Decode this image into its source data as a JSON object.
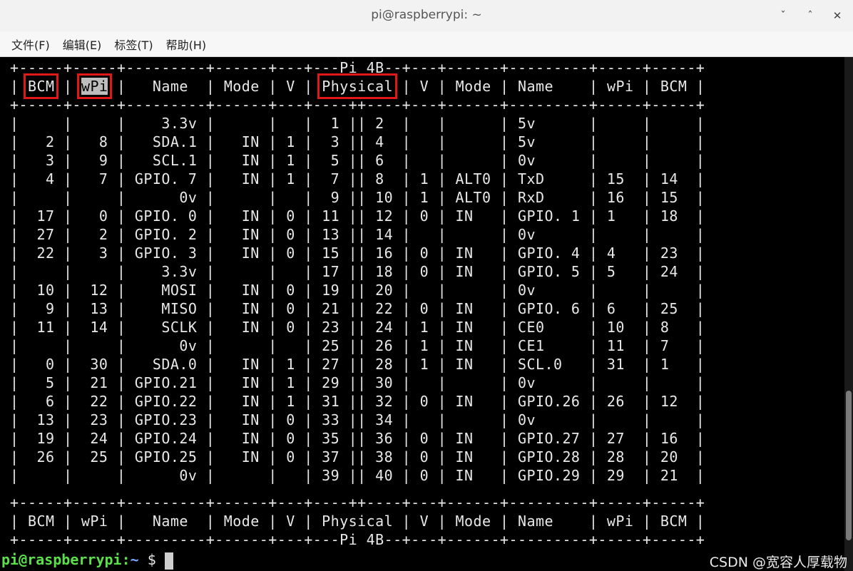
{
  "window": {
    "title": "pi@raspberrypi: ~",
    "buttons": {
      "minimize": "ˇ",
      "restore": "ˆ",
      "close": "✕"
    }
  },
  "menu": [
    "文件(F)",
    "编辑(E)",
    "标签(T)",
    "帮助(H)"
  ],
  "terminal": {
    "border_top": "+-----+-----+---------+------+---+---Pi 4B--+---+------+---------+-----+-----+",
    "header": {
      "p1": "| ",
      "bcm": "BCM",
      "p2": " | ",
      "wpi": "wPi",
      "p3": " |   Name  | Mode | V | ",
      "physical": "Physical",
      "p4": " | V | Mode | Name    | wPi | BCM |"
    },
    "border_mid": "+-----+-----+---------+------+---+----++----+---+------+---------+-----+-----+",
    "rows": [
      "|     |     |    3.3v |      |   |  1 || 2  |   |      | 5v      |     |     |",
      "|   2 |   8 |   SDA.1 |   IN | 1 |  3 || 4  |   |      | 5v      |     |     |",
      "|   3 |   9 |   SCL.1 |   IN | 1 |  5 || 6  |   |      | 0v      |     |     |",
      "|   4 |   7 | GPIO. 7 |   IN | 1 |  7 || 8  | 1 | ALT0 | TxD     | 15  | 14  |",
      "|     |     |      0v |      |   |  9 || 10 | 1 | ALT0 | RxD     | 16  | 15  |",
      "|  17 |   0 | GPIO. 0 |   IN | 0 | 11 || 12 | 0 | IN   | GPIO. 1 | 1   | 18  |",
      "|  27 |   2 | GPIO. 2 |   IN | 0 | 13 || 14 |   |      | 0v      |     |     |",
      "|  22 |   3 | GPIO. 3 |   IN | 0 | 15 || 16 | 0 | IN   | GPIO. 4 | 4   | 23  |",
      "|     |     |    3.3v |      |   | 17 || 18 | 0 | IN   | GPIO. 5 | 5   | 24  |",
      "|  10 |  12 |    MOSI |   IN | 0 | 19 || 20 |   |      | 0v      |     |     |",
      "|   9 |  13 |    MISO |   IN | 0 | 21 || 22 | 0 | IN   | GPIO. 6 | 6   | 25  |",
      "|  11 |  14 |    SCLK |   IN | 0 | 23 || 24 | 1 | IN   | CE0     | 10  | 8   |",
      "|     |     |      0v |      |   | 25 || 26 | 1 | IN   | CE1     | 11  | 7   |",
      "|   0 |  30 |   SDA.0 |   IN | 1 | 27 || 28 | 1 | IN   | SCL.0   | 31  | 1   |",
      "|   5 |  21 | GPIO.21 |   IN | 1 | 29 || 30 |   |      | 0v      |     |     |",
      "|   6 |  22 | GPIO.22 |   IN | 1 | 31 || 32 | 0 | IN   | GPIO.26 | 26  | 12  |",
      "|  13 |  23 | GPIO.23 |   IN | 0 | 33 || 34 |   |      | 0v      |     |     |",
      "|  19 |  24 | GPIO.24 |   IN | 0 | 35 || 36 | 0 | IN   | GPIO.27 | 27  | 16  |",
      "|  26 |  25 | GPIO.25 |   IN | 0 | 37 || 38 | 0 | IN   | GPIO.28 | 28  | 20  |",
      "|     |     |      0v |      |   | 39 || 40 | 0 | IN   | GPIO.29 | 29  | 21  |"
    ],
    "border_bot": "+-----+-----+---------+------+---+----++----+---+------+---------+-----+-----+",
    "footer": "| BCM | wPi |   Name  | Mode | V | Physical | V | Mode | Name    | wPi | BCM |",
    "border_end": "+-----+-----+---------+------+---+---Pi 4B--+---+------+---------+-----+-----+",
    "prompt_user": "pi@raspberrypi",
    "prompt_sep": ":",
    "prompt_dir": "~",
    "prompt_symbol": " $ "
  },
  "watermark": "CSDN @宽容人厚载物",
  "colors": {
    "highlight": "#e01818",
    "prompt_user": "#5be04c",
    "prompt_dir": "#7aa2ff"
  }
}
